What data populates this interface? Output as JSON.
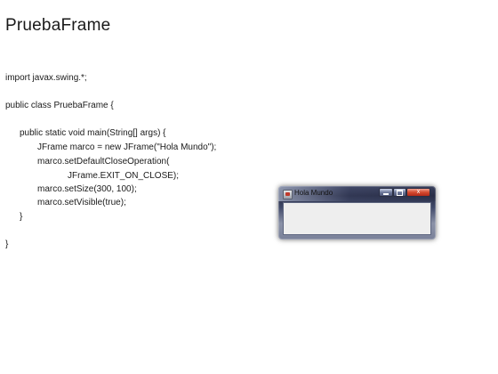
{
  "slide": {
    "title": "PruebaFrame"
  },
  "code": {
    "lines": [
      "import javax.swing.*;",
      "public class PruebaFrame {",
      "public static void main(String[] args) {",
      "JFrame marco = new JFrame(\"Hola Mundo\");",
      "marco.setDefaultCloseOperation(",
      "JFrame.EXIT_ON_CLOSE);",
      "marco.setSize(300, 100);",
      "marco.setVisible(true);",
      "}",
      "}"
    ]
  },
  "window": {
    "title": "Hola Mundo",
    "icon": "java-app-icon",
    "controls": {
      "minimize_icon": "minimize-icon",
      "maximize_icon": "maximize-icon",
      "close_label": "x"
    }
  }
}
